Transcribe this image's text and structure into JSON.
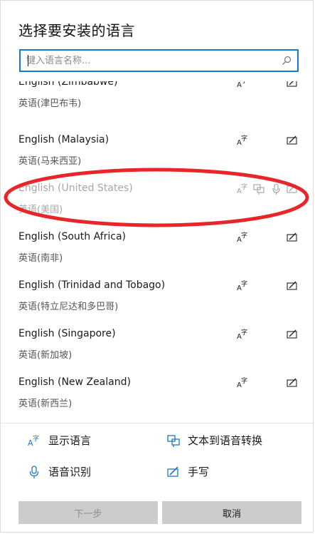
{
  "dialog": {
    "title": "选择要安装的语言",
    "search": {
      "placeholder": "键入语言名称...",
      "value": ""
    }
  },
  "languages": [
    {
      "name": "English (Zimbabwe)",
      "native": "英语(津巴布韦)",
      "features": [
        "display-language",
        "handwriting"
      ],
      "dimmed": false
    },
    {
      "name": "English (Malaysia)",
      "native": "英语(马来西亚)",
      "features": [
        "display-language",
        "handwriting"
      ],
      "dimmed": false
    },
    {
      "name": "English (United States)",
      "native": "英语(美国)",
      "features": [
        "display-language",
        "text-to-speech",
        "speech-recognition",
        "handwriting"
      ],
      "dimmed": true
    },
    {
      "name": "English (South Africa)",
      "native": "英语(南非)",
      "features": [
        "display-language",
        "handwriting"
      ],
      "dimmed": false
    },
    {
      "name": "English (Trinidad and Tobago)",
      "native": "英语(特立尼达和多巴哥)",
      "features": [
        "display-language",
        "handwriting"
      ],
      "dimmed": false
    },
    {
      "name": "English (Singapore)",
      "native": "英语(新加坡)",
      "features": [
        "display-language",
        "handwriting"
      ],
      "dimmed": false
    },
    {
      "name": "English (New Zealand)",
      "native": "英语(新西兰)",
      "features": [
        "display-language",
        "handwriting"
      ],
      "dimmed": false
    }
  ],
  "legend": {
    "display_language": "显示语言",
    "text_to_speech": "文本到语音转换",
    "speech_recognition": "语音识别",
    "handwriting": "手写"
  },
  "buttons": {
    "next": "下一步",
    "cancel": "取消"
  },
  "colors": {
    "accent": "#1979ca",
    "annotation": "#e8262a",
    "button_bg": "#cccccc"
  }
}
